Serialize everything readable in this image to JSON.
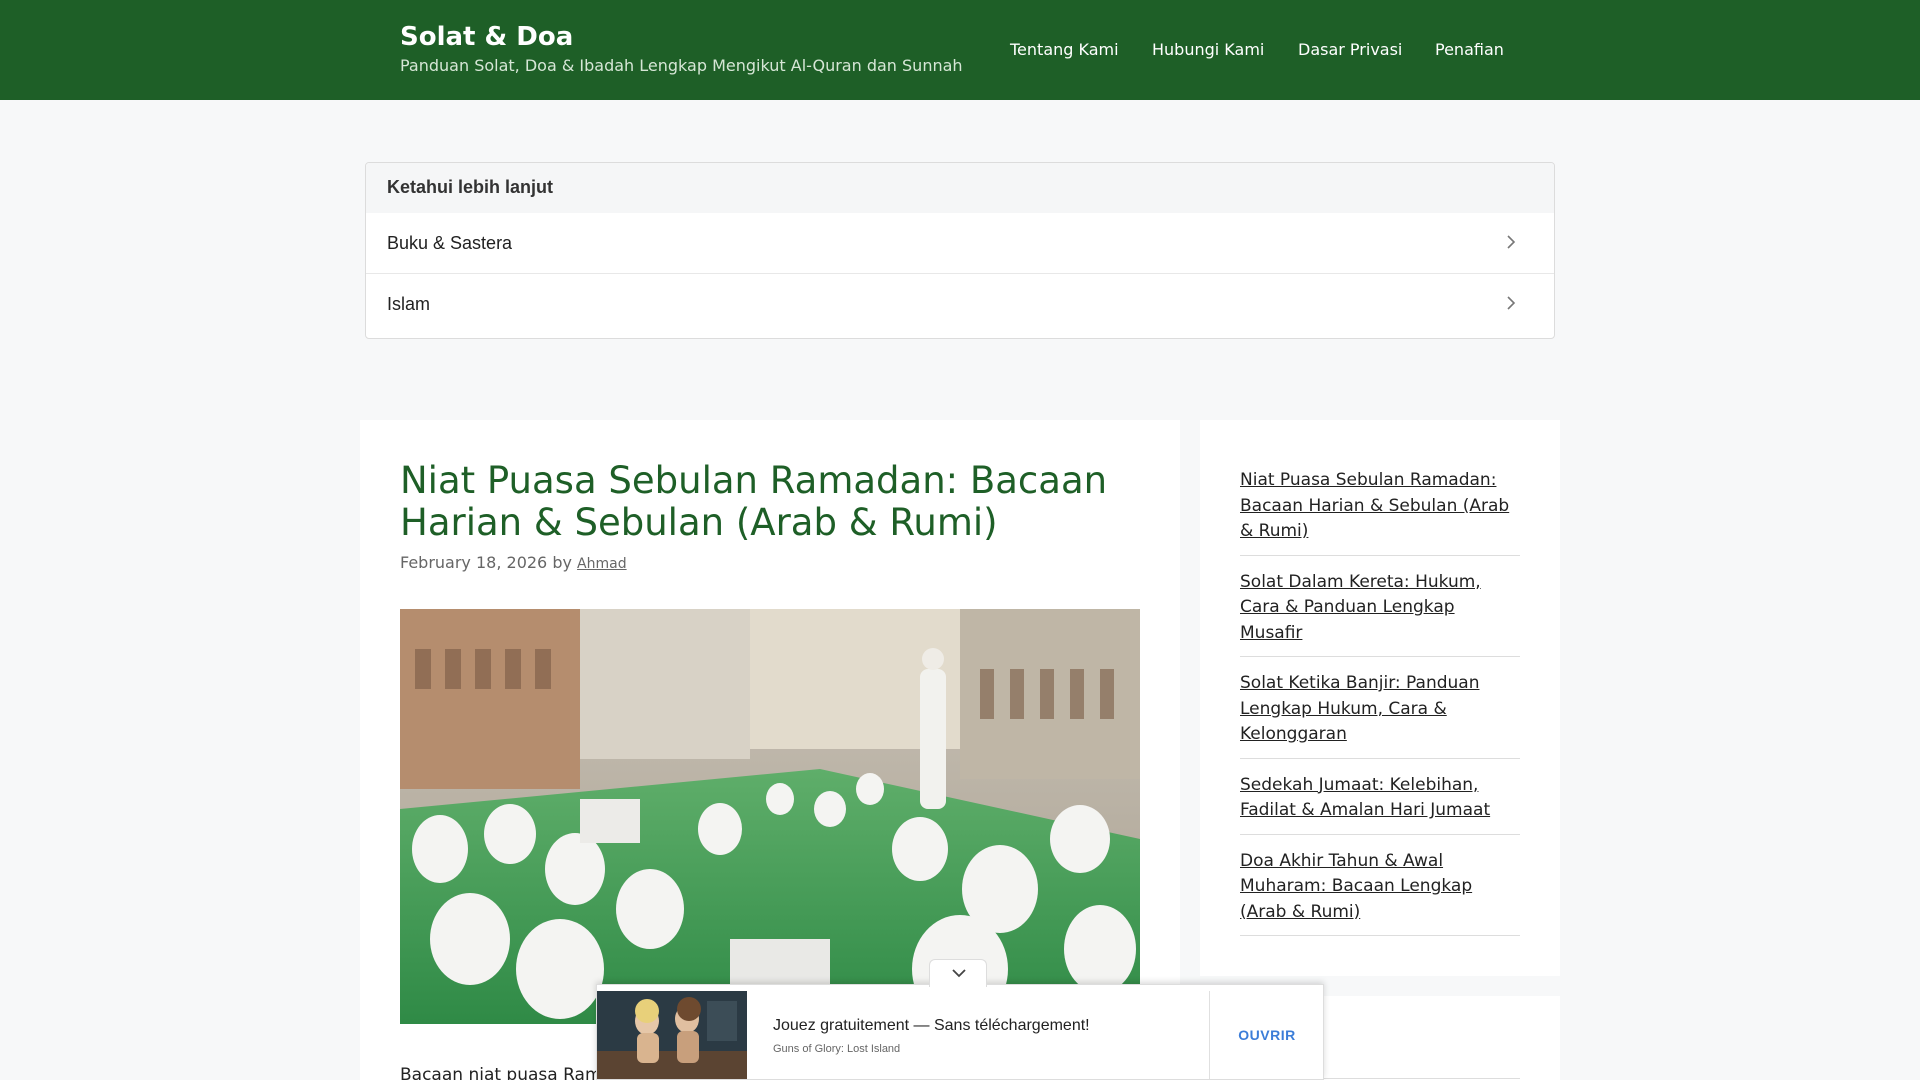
{
  "header": {
    "site_title": "Solat & Doa",
    "tagline": "Panduan Solat, Doa & Ibadah Lengkap Mengikut Al-Quran dan Sunnah",
    "nav": [
      "Tentang Kami",
      "Hubungi Kami",
      "Dasar Privasi",
      "Penafian"
    ]
  },
  "learn_more": {
    "heading": "Ketahui lebih lanjut",
    "items": [
      "Buku & Sastera",
      "Islam"
    ]
  },
  "article": {
    "title": "Niat Puasa Sebulan Ramadan: Bacaan Harian & Sebulan (Arab & Rumi)",
    "date": "February 18, 2026",
    "by": "by",
    "author": "Ahmad",
    "excerpt": "Bacaan niat puasa Ram"
  },
  "sidebar": {
    "recent_posts": [
      "Niat Puasa Sebulan Ramadan: Bacaan Harian & Sebulan (Arab & Rumi)",
      "Solat Dalam Kereta: Hukum, Cara & Panduan Lengkap Musafir",
      "Solat Ketika Banjir: Panduan Lengkap Hukum, Cara & Kelonggaran",
      "Sedekah Jumaat: Kelebihan, Fadilat & Amalan Hari Jumaat",
      "Doa Akhir Tahun & Awal Muharam: Bacaan Lengkap (Arab & Rumi)"
    ]
  },
  "ad": {
    "headline": "Jouez gratuitement — Sans téléchargement!",
    "source": "Guns of Glory: Lost Island",
    "cta": "OUVRIR"
  },
  "colors": {
    "header_bg": "#1e5f27",
    "title_green": "#1e5f27",
    "cta_blue": "#3b7dd8"
  }
}
